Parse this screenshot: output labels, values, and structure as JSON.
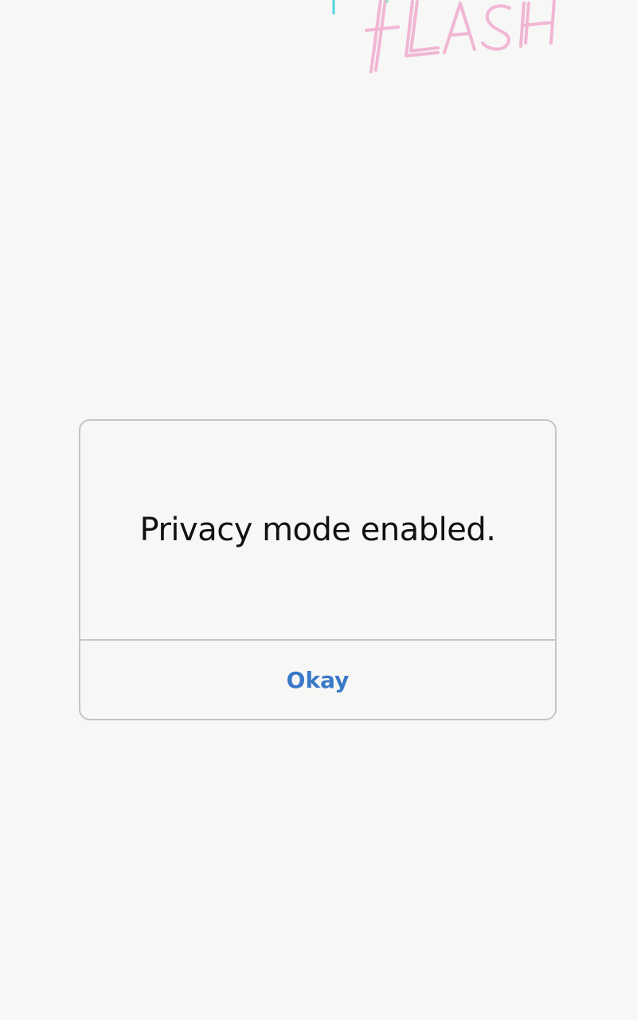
{
  "background": {
    "logo": {
      "icon": "flash-logo-icon",
      "text": "FLASH",
      "color": "#f1b6d4",
      "accent_color": "#4fd6dc"
    },
    "color": "#f7f7f6"
  },
  "dialog": {
    "message": "Privacy mode enabled.",
    "button_label": "Okay",
    "button_color": "#3a78c8",
    "border_color": "#c4c4c4"
  }
}
